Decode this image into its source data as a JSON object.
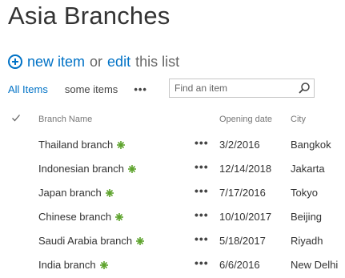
{
  "page": {
    "title": "Asia Branches"
  },
  "command_bar": {
    "new_item": "new item",
    "or": "or",
    "edit": "edit",
    "this_list": "this list"
  },
  "views": {
    "all_items": "All Items",
    "some_items": "some items",
    "more": "•••"
  },
  "search": {
    "placeholder": "Find an item"
  },
  "columns": {
    "check": "✓",
    "branch_name": "Branch Name",
    "opening_date": "Opening date",
    "city": "City"
  },
  "item_menu": "•••",
  "rows": [
    {
      "name": "Thailand branch",
      "opening_date": "3/2/2016",
      "city": "Bangkok",
      "new": true
    },
    {
      "name": "Indonesian branch",
      "opening_date": "12/14/2018",
      "city": "Jakarta",
      "new": true
    },
    {
      "name": "Japan branch",
      "opening_date": "7/17/2016",
      "city": "Tokyo",
      "new": true
    },
    {
      "name": "Chinese branch",
      "opening_date": "10/10/2017",
      "city": "Beijing",
      "new": true
    },
    {
      "name": "Saudi Arabia branch",
      "opening_date": "5/18/2017",
      "city": "Riyadh",
      "new": true
    },
    {
      "name": "India branch",
      "opening_date": "6/6/2016",
      "city": "New Delhi",
      "new": true
    }
  ],
  "colors": {
    "link": "#0072c6",
    "new_icon": "#5ea32d",
    "text": "#333333"
  }
}
